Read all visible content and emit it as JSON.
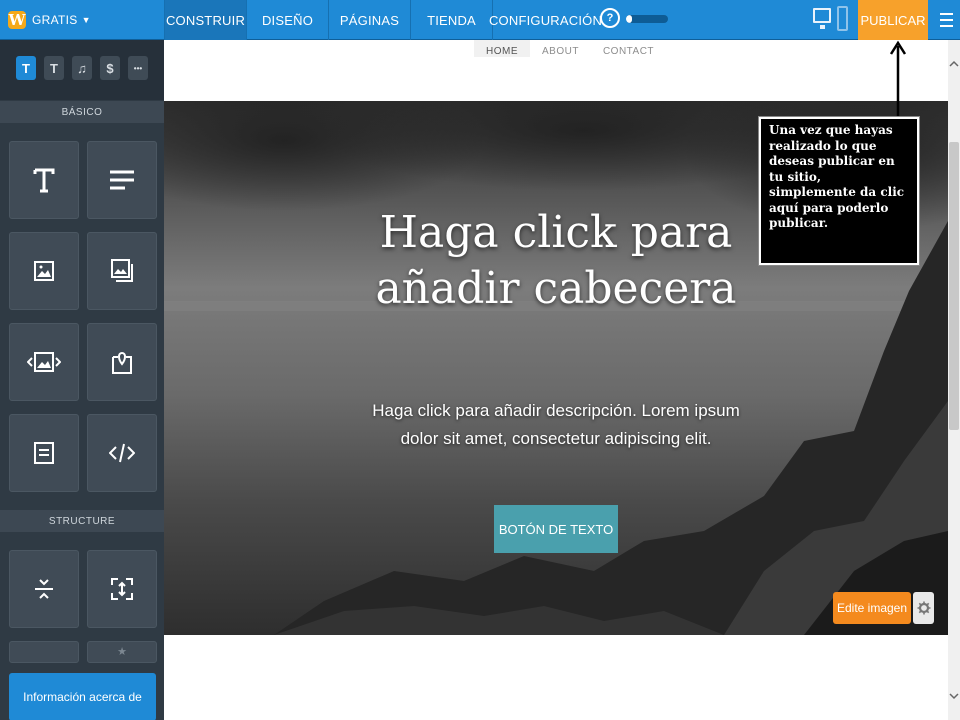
{
  "brand": {
    "logo_letter": "W",
    "plan": "GRATIS",
    "accent": "#1f8ad6",
    "publish_color": "#f7a12b"
  },
  "nav": {
    "items": [
      {
        "label": "CONSTRUIR",
        "active": true
      },
      {
        "label": "DISEÑO"
      },
      {
        "label": "PÁGINAS"
      },
      {
        "label": "TIENDA"
      },
      {
        "label": "CONFIGURACIÓN"
      }
    ],
    "help": "?",
    "progress": 0.15
  },
  "toolbar": {
    "publish_label": "PUBLICAR",
    "icons": [
      "desktop-icon",
      "mobile-icon",
      "menu-icon"
    ]
  },
  "sidebar": {
    "categories": [
      {
        "icon": "text-category-icon",
        "glyph": "T",
        "active": true
      },
      {
        "icon": "layout-category-icon",
        "glyph": "T"
      },
      {
        "icon": "music-category-icon",
        "glyph": "♫"
      },
      {
        "icon": "commerce-category-icon",
        "glyph": "$"
      },
      {
        "icon": "more-category-icon",
        "glyph": "•••"
      }
    ],
    "basic_heading": "BÁSICO",
    "basic_tiles": [
      "title-icon",
      "text-icon",
      "image-icon",
      "gallery-icon",
      "slideshow-icon",
      "map-icon",
      "contact-form-icon",
      "embed-code-icon"
    ],
    "structure_heading": "STRUCTURE",
    "structure_tiles": [
      "divider-icon",
      "spacer-icon"
    ],
    "info_button": "Información acerca de"
  },
  "site": {
    "nav": [
      "HOME",
      "ABOUT",
      "CONTACT"
    ],
    "hero": {
      "title": "Haga click para añadir cabecera",
      "description": "Haga click para añadir descripción. Lorem ipsum dolor sit amet, consectetur adipiscing elit.",
      "button": "BOTÓN DE TEXTO",
      "edit_image": "Edite imagen"
    }
  },
  "callout": {
    "text": "Una vez que hayas realizado lo que deseas publicar en tu sitio, simplemente da clic aquí para poderlo publicar."
  }
}
